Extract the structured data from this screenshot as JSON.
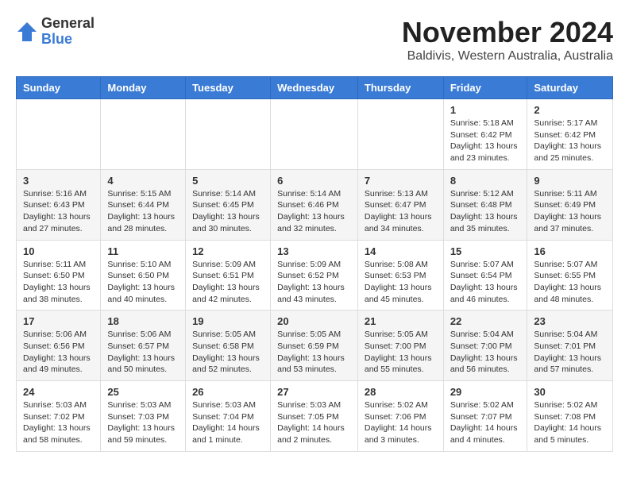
{
  "logo": {
    "general": "General",
    "blue": "Blue"
  },
  "title": "November 2024",
  "location": "Baldivis, Western Australia, Australia",
  "weekdays": [
    "Sunday",
    "Monday",
    "Tuesday",
    "Wednesday",
    "Thursday",
    "Friday",
    "Saturday"
  ],
  "weeks": [
    [
      {
        "day": "",
        "info": ""
      },
      {
        "day": "",
        "info": ""
      },
      {
        "day": "",
        "info": ""
      },
      {
        "day": "",
        "info": ""
      },
      {
        "day": "",
        "info": ""
      },
      {
        "day": "1",
        "info": "Sunrise: 5:18 AM\nSunset: 6:42 PM\nDaylight: 13 hours and 23 minutes."
      },
      {
        "day": "2",
        "info": "Sunrise: 5:17 AM\nSunset: 6:42 PM\nDaylight: 13 hours and 25 minutes."
      }
    ],
    [
      {
        "day": "3",
        "info": "Sunrise: 5:16 AM\nSunset: 6:43 PM\nDaylight: 13 hours and 27 minutes."
      },
      {
        "day": "4",
        "info": "Sunrise: 5:15 AM\nSunset: 6:44 PM\nDaylight: 13 hours and 28 minutes."
      },
      {
        "day": "5",
        "info": "Sunrise: 5:14 AM\nSunset: 6:45 PM\nDaylight: 13 hours and 30 minutes."
      },
      {
        "day": "6",
        "info": "Sunrise: 5:14 AM\nSunset: 6:46 PM\nDaylight: 13 hours and 32 minutes."
      },
      {
        "day": "7",
        "info": "Sunrise: 5:13 AM\nSunset: 6:47 PM\nDaylight: 13 hours and 34 minutes."
      },
      {
        "day": "8",
        "info": "Sunrise: 5:12 AM\nSunset: 6:48 PM\nDaylight: 13 hours and 35 minutes."
      },
      {
        "day": "9",
        "info": "Sunrise: 5:11 AM\nSunset: 6:49 PM\nDaylight: 13 hours and 37 minutes."
      }
    ],
    [
      {
        "day": "10",
        "info": "Sunrise: 5:11 AM\nSunset: 6:50 PM\nDaylight: 13 hours and 38 minutes."
      },
      {
        "day": "11",
        "info": "Sunrise: 5:10 AM\nSunset: 6:50 PM\nDaylight: 13 hours and 40 minutes."
      },
      {
        "day": "12",
        "info": "Sunrise: 5:09 AM\nSunset: 6:51 PM\nDaylight: 13 hours and 42 minutes."
      },
      {
        "day": "13",
        "info": "Sunrise: 5:09 AM\nSunset: 6:52 PM\nDaylight: 13 hours and 43 minutes."
      },
      {
        "day": "14",
        "info": "Sunrise: 5:08 AM\nSunset: 6:53 PM\nDaylight: 13 hours and 45 minutes."
      },
      {
        "day": "15",
        "info": "Sunrise: 5:07 AM\nSunset: 6:54 PM\nDaylight: 13 hours and 46 minutes."
      },
      {
        "day": "16",
        "info": "Sunrise: 5:07 AM\nSunset: 6:55 PM\nDaylight: 13 hours and 48 minutes."
      }
    ],
    [
      {
        "day": "17",
        "info": "Sunrise: 5:06 AM\nSunset: 6:56 PM\nDaylight: 13 hours and 49 minutes."
      },
      {
        "day": "18",
        "info": "Sunrise: 5:06 AM\nSunset: 6:57 PM\nDaylight: 13 hours and 50 minutes."
      },
      {
        "day": "19",
        "info": "Sunrise: 5:05 AM\nSunset: 6:58 PM\nDaylight: 13 hours and 52 minutes."
      },
      {
        "day": "20",
        "info": "Sunrise: 5:05 AM\nSunset: 6:59 PM\nDaylight: 13 hours and 53 minutes."
      },
      {
        "day": "21",
        "info": "Sunrise: 5:05 AM\nSunset: 7:00 PM\nDaylight: 13 hours and 55 minutes."
      },
      {
        "day": "22",
        "info": "Sunrise: 5:04 AM\nSunset: 7:00 PM\nDaylight: 13 hours and 56 minutes."
      },
      {
        "day": "23",
        "info": "Sunrise: 5:04 AM\nSunset: 7:01 PM\nDaylight: 13 hours and 57 minutes."
      }
    ],
    [
      {
        "day": "24",
        "info": "Sunrise: 5:03 AM\nSunset: 7:02 PM\nDaylight: 13 hours and 58 minutes."
      },
      {
        "day": "25",
        "info": "Sunrise: 5:03 AM\nSunset: 7:03 PM\nDaylight: 13 hours and 59 minutes."
      },
      {
        "day": "26",
        "info": "Sunrise: 5:03 AM\nSunset: 7:04 PM\nDaylight: 14 hours and 1 minute."
      },
      {
        "day": "27",
        "info": "Sunrise: 5:03 AM\nSunset: 7:05 PM\nDaylight: 14 hours and 2 minutes."
      },
      {
        "day": "28",
        "info": "Sunrise: 5:02 AM\nSunset: 7:06 PM\nDaylight: 14 hours and 3 minutes."
      },
      {
        "day": "29",
        "info": "Sunrise: 5:02 AM\nSunset: 7:07 PM\nDaylight: 14 hours and 4 minutes."
      },
      {
        "day": "30",
        "info": "Sunrise: 5:02 AM\nSunset: 7:08 PM\nDaylight: 14 hours and 5 minutes."
      }
    ]
  ]
}
